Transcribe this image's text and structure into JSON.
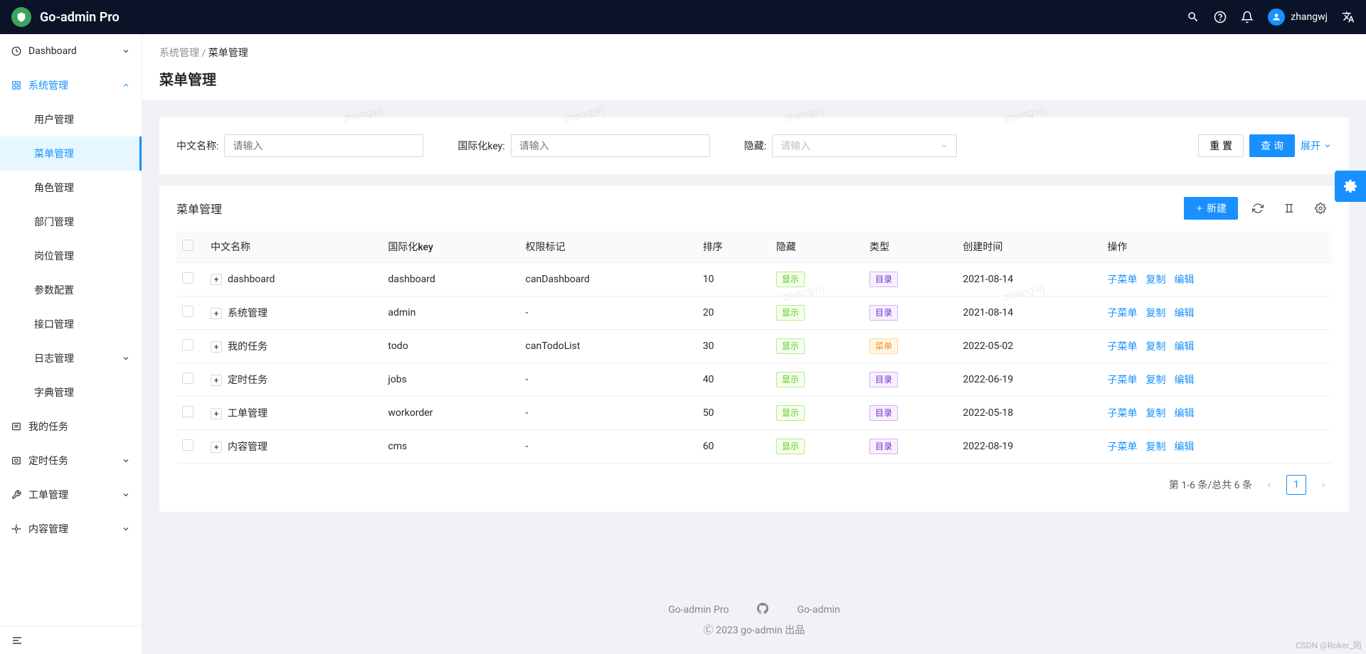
{
  "header": {
    "brand": "Go-admin Pro",
    "username": "zhangwj"
  },
  "sidebar": {
    "items": [
      {
        "label": "Dashboard",
        "icon": "dashboard",
        "expandable": true,
        "expanded": false
      },
      {
        "label": "系统管理",
        "icon": "setting",
        "expandable": true,
        "expanded": true,
        "selected": true,
        "children": [
          {
            "label": "用户管理"
          },
          {
            "label": "菜单管理",
            "active": true
          },
          {
            "label": "角色管理"
          },
          {
            "label": "部门管理"
          },
          {
            "label": "岗位管理"
          },
          {
            "label": "参数配置"
          },
          {
            "label": "接口管理"
          },
          {
            "label": "日志管理",
            "expandable": true
          },
          {
            "label": "字典管理"
          }
        ]
      },
      {
        "label": "我的任务",
        "icon": "todo"
      },
      {
        "label": "定时任务",
        "icon": "clock",
        "expandable": true
      },
      {
        "label": "工单管理",
        "icon": "tool",
        "expandable": true
      },
      {
        "label": "内容管理",
        "icon": "gear",
        "expandable": true
      }
    ]
  },
  "breadcrumb": {
    "a": "系统管理",
    "b": "菜单管理"
  },
  "page_title": "菜单管理",
  "search": {
    "name_label": "中文名称:",
    "name_placeholder": "请输入",
    "key_label": "国际化key:",
    "key_placeholder": "请输入",
    "hidden_label": "隐藏:",
    "hidden_placeholder": "请输入",
    "reset": "重 置",
    "query": "查 询",
    "expand": "展开"
  },
  "table": {
    "title": "菜单管理",
    "new_button": "新建",
    "columns": {
      "name": "中文名称",
      "key": "国际化key",
      "perm": "权限标记",
      "sort": "排序",
      "hidden": "隐藏",
      "type": "类型",
      "created": "创建时间",
      "ops": "操作"
    },
    "hidden_tag_show": "显示",
    "type_tag_dir": "目录",
    "type_tag_menu": "菜单",
    "actions": {
      "sub": "子菜单",
      "copy": "复制",
      "edit": "编辑"
    },
    "rows": [
      {
        "name": "dashboard",
        "key": "dashboard",
        "perm": "canDashboard",
        "sort": "10",
        "hidden": "显示",
        "type": "目录",
        "type_class": "purple",
        "created": "2021-08-14"
      },
      {
        "name": "系统管理",
        "key": "admin",
        "perm": "-",
        "sort": "20",
        "hidden": "显示",
        "type": "目录",
        "type_class": "purple",
        "created": "2021-08-14"
      },
      {
        "name": "我的任务",
        "key": "todo",
        "perm": "canTodoList",
        "sort": "30",
        "hidden": "显示",
        "type": "菜单",
        "type_class": "orange",
        "created": "2022-05-02"
      },
      {
        "name": "定时任务",
        "key": "jobs",
        "perm": "-",
        "sort": "40",
        "hidden": "显示",
        "type": "目录",
        "type_class": "purple",
        "created": "2022-06-19"
      },
      {
        "name": "工单管理",
        "key": "workorder",
        "perm": "-",
        "sort": "50",
        "hidden": "显示",
        "type": "目录",
        "type_class": "purple",
        "created": "2022-05-18"
      },
      {
        "name": "内容管理",
        "key": "cms",
        "perm": "-",
        "sort": "60",
        "hidden": "显示",
        "type": "目录",
        "type_class": "purple",
        "created": "2022-08-19"
      }
    ],
    "pagination": {
      "summary": "第 1-6 条/总共 6 条",
      "page": "1"
    }
  },
  "footer": {
    "link1": "Go-admin Pro",
    "link2": "Go-admin",
    "copyright": "Ⓒ 2023 go-admin 出品"
  },
  "watermark": "zhangwj",
  "credit": "CSDN @Roker_陌"
}
